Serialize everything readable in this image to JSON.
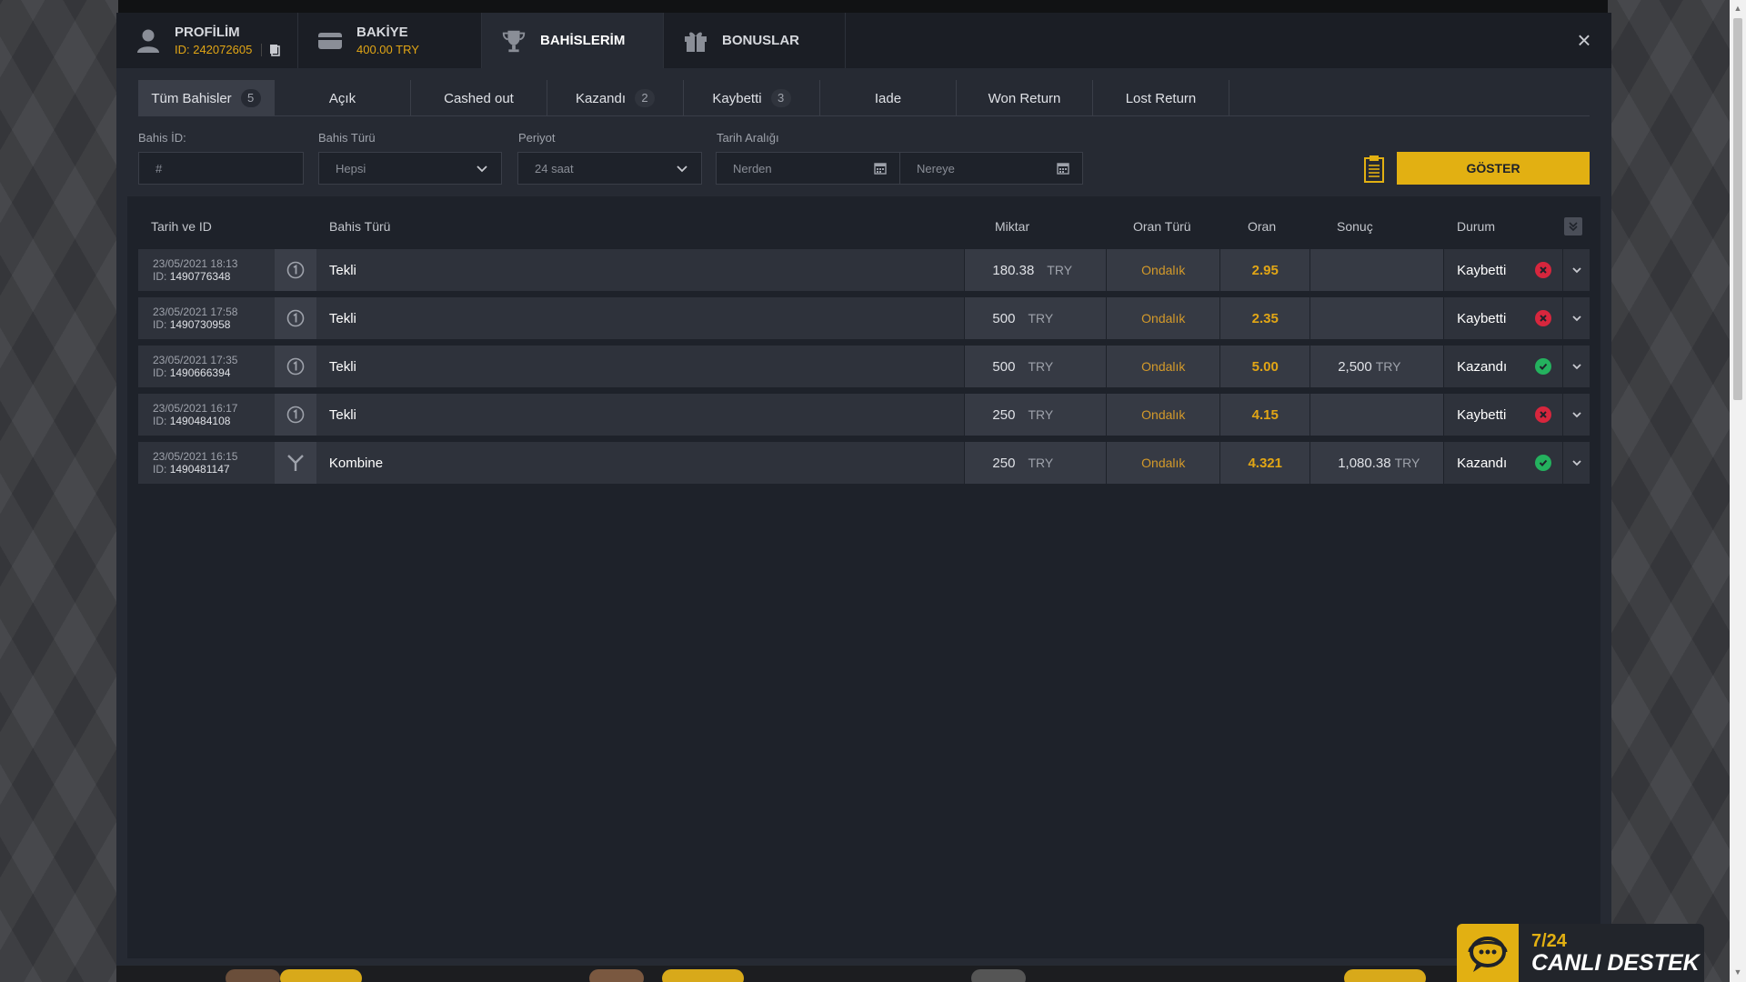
{
  "header": {
    "profile": {
      "title": "PROFİLİM",
      "id_label": "ID: 242072605"
    },
    "balance": {
      "title": "BAKİYE",
      "amount": "400.00 TRY"
    },
    "bets": {
      "title": "BAHİSLERİM"
    },
    "bonus": {
      "title": "BONUSLAR"
    },
    "close_label": "×"
  },
  "subtabs": [
    {
      "label": "Tüm Bahisler",
      "count": "5"
    },
    {
      "label": "Açık",
      "count": ""
    },
    {
      "label": "Cashed out",
      "count": ""
    },
    {
      "label": "Kazandı",
      "count": "2"
    },
    {
      "label": "Kaybetti",
      "count": "3"
    },
    {
      "label": "Iade",
      "count": ""
    },
    {
      "label": "Won Return",
      "count": ""
    },
    {
      "label": "Lost Return",
      "count": ""
    }
  ],
  "filters": {
    "bet_id_label": "Bahis İD:",
    "bet_id_placeholder": "#",
    "bet_type_label": "Bahis Türü",
    "bet_type_value": "Hepsi",
    "period_label": "Periyot",
    "period_value": "24 saat",
    "date_range_label": "Tarih Aralığı",
    "from_placeholder": "Nerden",
    "to_placeholder": "Nereye",
    "show_button": "GÖSTER"
  },
  "table": {
    "columns": {
      "date_id": "Tarih ve ID",
      "bet_type": "Bahis Türü",
      "amount": "Miktar",
      "odds_type": "Oran Türü",
      "odds": "Oran",
      "result": "Sonuç",
      "status": "Durum"
    },
    "rows": [
      {
        "date": "23/05/2021 18:13",
        "id_prefix": "ID:",
        "id": "1490776348",
        "icon": "single-bet-icon",
        "type": "Tekli",
        "amount": "180.38",
        "currency": "TRY",
        "odds_type": "Ondalık",
        "odds": "2.95",
        "result": "",
        "result_currency": "",
        "status": "Kaybetti",
        "status_kind": "lost"
      },
      {
        "date": "23/05/2021 17:58",
        "id_prefix": "ID:",
        "id": "1490730958",
        "icon": "single-bet-icon",
        "type": "Tekli",
        "amount": "500",
        "currency": "TRY",
        "odds_type": "Ondalık",
        "odds": "2.35",
        "result": "",
        "result_currency": "",
        "status": "Kaybetti",
        "status_kind": "lost"
      },
      {
        "date": "23/05/2021 17:35",
        "id_prefix": "ID:",
        "id": "1490666394",
        "icon": "single-bet-icon",
        "type": "Tekli",
        "amount": "500",
        "currency": "TRY",
        "odds_type": "Ondalık",
        "odds": "5.00",
        "result": "2,500",
        "result_currency": "TRY",
        "status": "Kazandı",
        "status_kind": "won"
      },
      {
        "date": "23/05/2021 16:17",
        "id_prefix": "ID:",
        "id": "1490484108",
        "icon": "single-bet-icon",
        "type": "Tekli",
        "amount": "250",
        "currency": "TRY",
        "odds_type": "Ondalık",
        "odds": "4.15",
        "result": "",
        "result_currency": "",
        "status": "Kaybetti",
        "status_kind": "lost"
      },
      {
        "date": "23/05/2021 16:15",
        "id_prefix": "ID:",
        "id": "1490481147",
        "icon": "combo-bet-icon",
        "type": "Kombine",
        "amount": "250",
        "currency": "TRY",
        "odds_type": "Ondalık",
        "odds": "4.321",
        "result": "1,080.38",
        "result_currency": "TRY",
        "status": "Kazandı",
        "status_kind": "won"
      }
    ]
  },
  "support": {
    "line1": "7/24",
    "line2": "CANLI DESTEK"
  },
  "colors": {
    "accent": "#e2b012",
    "won": "#24b15e",
    "lost": "#d7263d"
  }
}
